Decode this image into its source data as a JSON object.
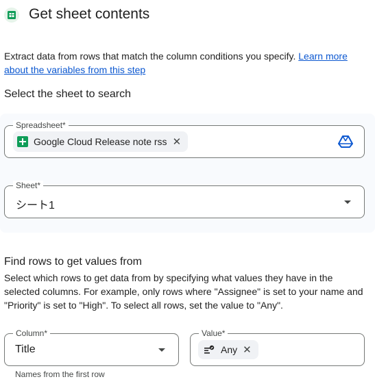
{
  "header": {
    "title": "Get sheet contents",
    "icon": "google-sheets-icon"
  },
  "description": {
    "text": "Extract data from rows that match the column conditions you specify. ",
    "link": "Learn more about the variables from this step"
  },
  "select_sheet": {
    "heading": "Select the sheet to search",
    "spreadsheet": {
      "label": "Spreadsheet*",
      "chip_label": "Google Cloud Release note rss",
      "chip_icon": "google-sheets-icon",
      "trailing_icon": "google-drive-icon"
    },
    "sheet": {
      "label": "Sheet*",
      "value": "シート1"
    }
  },
  "find_rows": {
    "heading": "Find rows to get values from",
    "description": "Select which rows to get data from by specifying what values they have in the selected columns. For example, only rows where \"Assignee\" is set to your name and \"Priority\" is set to \"High\". To select all rows, set the value to \"Any\".",
    "column": {
      "label": "Column*",
      "value": "Title",
      "helper": "Names from the first row"
    },
    "value": {
      "label": "Value*",
      "chip_label": "Any",
      "chip_icon": "filter-list-icon"
    }
  },
  "colors": {
    "link": "#0b57d0",
    "sheets_green": "#0f9d58",
    "drive_blue": "#0b57d0",
    "panel_bg": "#f8fafd"
  }
}
